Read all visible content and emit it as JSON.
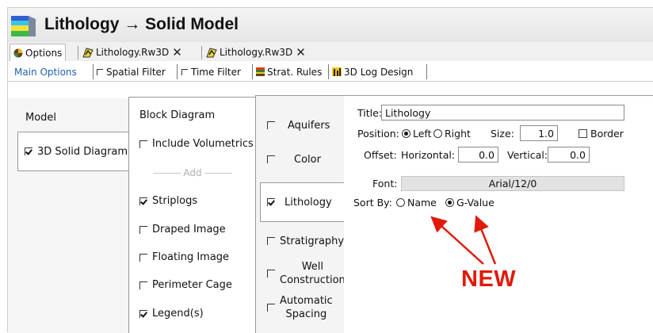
{
  "window": {
    "title": "Lithology → Solid Model"
  },
  "doc_tabs": [
    {
      "label": "Options",
      "icon": "options-icon"
    },
    {
      "label": "Lithology.Rw3D",
      "icon": "rockworks-3d-icon",
      "close": "✕"
    },
    {
      "label": "Lithology.Rw3D",
      "icon": "rockworks-3d-icon",
      "close": "✕"
    }
  ],
  "option_tabs": [
    {
      "label": "Main Options"
    },
    {
      "label": "Spatial Filter"
    },
    {
      "label": "Time Filter"
    },
    {
      "label": "Strat. Rules",
      "icon": "strat-rules-icon"
    },
    {
      "label": "3D Log Design",
      "icon": "log-design-icon"
    }
  ],
  "col1": {
    "header": "Model",
    "items": [
      {
        "label": "3D Solid Diagram",
        "checked": true
      }
    ]
  },
  "col2": {
    "header": "Block Diagram",
    "include_volumetrics": "Include Volumetrics",
    "add_label": "Add",
    "items": [
      {
        "label": "Striplogs",
        "checked": true
      },
      {
        "label": "Draped Image",
        "checked": false
      },
      {
        "label": "Floating Image",
        "checked": false
      },
      {
        "label": "Perimeter Cage",
        "checked": false
      },
      {
        "label": "Legend(s)",
        "checked": true
      }
    ]
  },
  "col3": {
    "items": [
      {
        "label": "Aquifers",
        "checked": false
      },
      {
        "label": "Color",
        "checked": false
      },
      {
        "label": "Lithology",
        "checked": true
      },
      {
        "label": "Stratigraphy",
        "checked": false
      },
      {
        "label_line1": "Well",
        "label_line2": "Construction",
        "checked": false
      },
      {
        "label_line1": "Automatic",
        "label_line2": "Spacing",
        "checked": false
      }
    ]
  },
  "settings": {
    "title_label": "Title:",
    "title_value": "Lithology",
    "position_label": "Position:",
    "position_left": "Left",
    "position_right": "Right",
    "position_selected": "Left",
    "size_label": "Size:",
    "size_value": "1.0",
    "border_label": "Border",
    "offset_label": "Offset:",
    "horizontal_label": "Horizontal:",
    "horizontal_value": "0.0",
    "vertical_label": "Vertical:",
    "vertical_value": "0.0",
    "font_label": "Font:",
    "font_value": "Arial/12/0",
    "sort_label": "Sort By:",
    "sort_name": "Name",
    "sort_gvalue": "G-Value",
    "sort_selected": "G-Value"
  },
  "annotation": {
    "text": "NEW",
    "color": "#e01b0b"
  },
  "colors": {
    "active_tab_text": "#1f5fb4"
  }
}
